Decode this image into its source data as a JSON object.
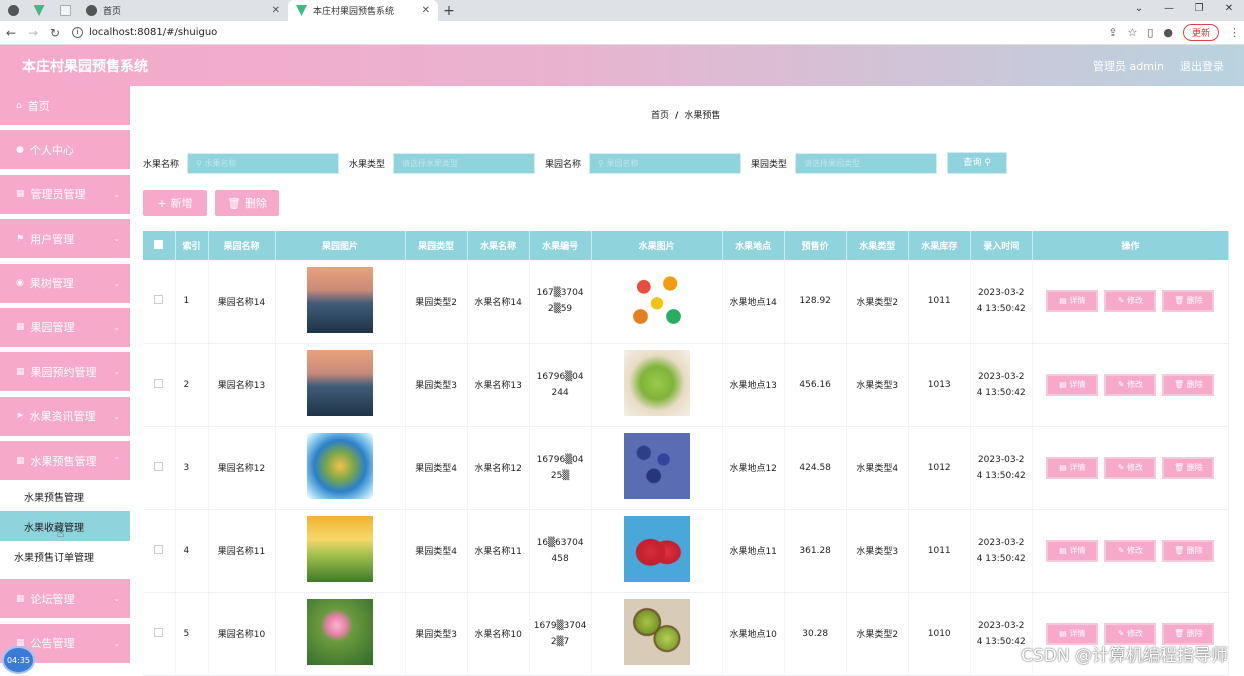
{
  "browser": {
    "tabs": [
      {
        "label": ""
      },
      {
        "label": ""
      },
      {
        "label": ""
      },
      {
        "label": "首页"
      },
      {
        "label": "本庄村果园预售系统"
      }
    ],
    "url": "localhost:8081/#/shuiguo",
    "update_label": "更新"
  },
  "header": {
    "title": "本庄村果园预售系统",
    "user": "管理员 admin",
    "logout": "退出登录"
  },
  "sidebar": {
    "menus": [
      {
        "label": "首页"
      },
      {
        "label": "个人中心"
      },
      {
        "label": "管理员管理"
      },
      {
        "label": "用户管理"
      },
      {
        "label": "果树管理"
      },
      {
        "label": "果园管理"
      },
      {
        "label": "果园预约管理"
      },
      {
        "label": "水果资讯管理"
      },
      {
        "label": "水果预售管理"
      }
    ],
    "subs": [
      {
        "label": "水果预售管理"
      },
      {
        "label": "水果收藏管理"
      },
      {
        "label": "水果预售订单管理"
      }
    ],
    "menus2": [
      {
        "label": "论坛管理"
      },
      {
        "label": "公告管理"
      }
    ],
    "timer": "04:35"
  },
  "breadcrumb": {
    "home": "首页",
    "sep": "/",
    "current": "水果预售"
  },
  "search": {
    "f1_label": "水果名称",
    "f1_ph": "水果名称",
    "f2_label": "水果类型",
    "f2_ph": "请选择水果类型",
    "f3_label": "果园名称",
    "f3_ph": "果园名称",
    "f4_label": "果园类型",
    "f4_ph": "请选择果园类型",
    "query": "查询"
  },
  "actions": {
    "add": "新增",
    "delete": "删除"
  },
  "table": {
    "headers": [
      "",
      "索引",
      "果园名称",
      "果园图片",
      "果园类型",
      "水果名称",
      "水果编号",
      "水果图片",
      "水果地点",
      "预售价",
      "水果类型",
      "水果库存",
      "录入时间",
      "操作"
    ],
    "rows": [
      {
        "idx": "1",
        "orchard": "果园名称14",
        "otype": "果园类型2",
        "fruit": "水果名称14",
        "code1": "167▒3704",
        "code2": "2▒59",
        "place": "水果地点14",
        "price": "128.92",
        "ftype": "水果类型2",
        "stock": "1011",
        "time1": "2023-03-2",
        "time2": "4 13:50:42",
        "opic": "sunset",
        "fpic": "fruits"
      },
      {
        "idx": "2",
        "orchard": "果园名称13",
        "otype": "果园类型3",
        "fruit": "水果名称13",
        "code1": "16796▒04",
        "code2": "244",
        "place": "水果地点13",
        "price": "456.16",
        "ftype": "水果类型3",
        "stock": "1013",
        "time1": "2023-03-2",
        "time2": "4 13:50:42",
        "opic": "sunset",
        "fpic": "grapes"
      },
      {
        "idx": "3",
        "orchard": "果园名称12",
        "otype": "果园类型4",
        "fruit": "水果名称12",
        "code1": "16796▒04",
        "code2": "25▒",
        "place": "水果地点12",
        "price": "424.58",
        "ftype": "水果类型4",
        "stock": "1012",
        "time1": "2023-03-2",
        "time2": "4 13:50:42",
        "opic": "planet",
        "fpic": "blueberry"
      },
      {
        "idx": "4",
        "orchard": "果园名称11",
        "otype": "果园类型4",
        "fruit": "水果名称11",
        "code1": "16▒63704",
        "code2": "458",
        "place": "水果地点11",
        "price": "361.28",
        "ftype": "水果类型3",
        "stock": "1011",
        "time1": "2023-03-2",
        "time2": "4 13:50:42",
        "opic": "meadow",
        "fpic": "strawberry"
      },
      {
        "idx": "5",
        "orchard": "果园名称10",
        "otype": "果园类型3",
        "fruit": "水果名称10",
        "code1": "1679▒3704",
        "code2": "2▒7",
        "place": "水果地点10",
        "price": "30.28",
        "ftype": "水果类型2",
        "stock": "1010",
        "time1": "2023-03-2",
        "time2": "4 13:50:42",
        "opic": "lotus",
        "fpic": "kiwi"
      }
    ],
    "ops": {
      "detail": "详情",
      "edit": "修改",
      "del": "删除"
    }
  },
  "watermark": "CSDN @计算机编程指导师",
  "colors": {
    "pink": "#f6a9c9",
    "teal": "#8fd3dc"
  }
}
